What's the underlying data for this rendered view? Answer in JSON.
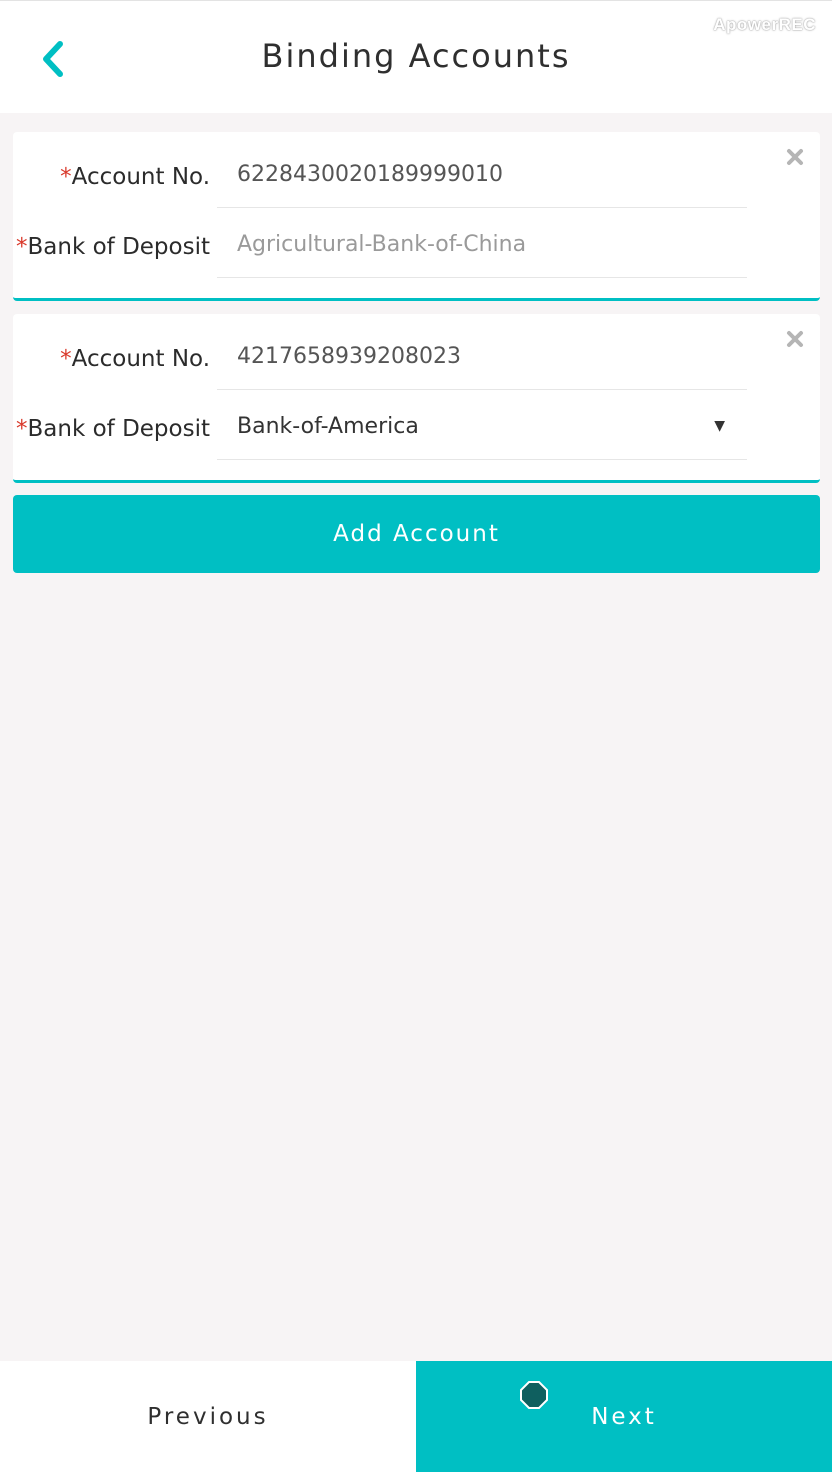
{
  "header": {
    "title": "Binding Accounts",
    "watermark": "ApowerREC",
    "back_icon": "chevron-left-icon"
  },
  "accent_color": "#00bfc3",
  "required_color": "#d9392b",
  "accounts": [
    {
      "account_label": "Account No.",
      "account_value": "6228430020189999010",
      "bank_label": "Bank of Deposit",
      "bank_placeholder": "Agricultural-Bank-of-China",
      "required_marker": "*"
    },
    {
      "account_label": "Account No.",
      "account_value": "4217658939208023",
      "bank_label": "Bank of Deposit",
      "bank_selected": "Bank-of-America",
      "required_marker": "*"
    }
  ],
  "actions": {
    "add_account": "Add Account",
    "previous": "Previous",
    "next": "Next"
  }
}
